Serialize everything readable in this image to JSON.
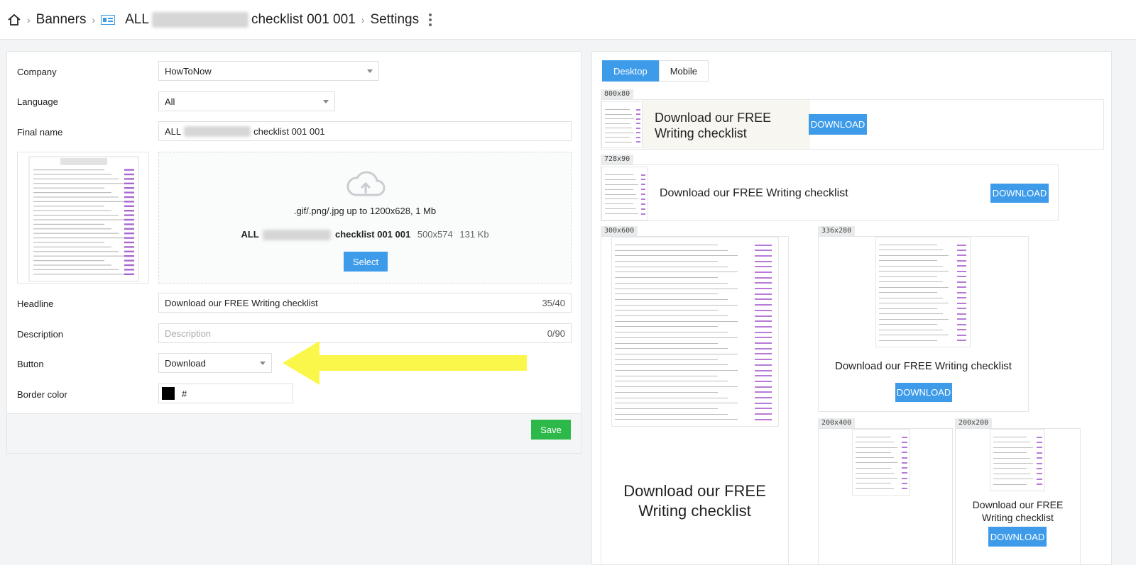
{
  "breadcrumb": {
    "banners": "Banners",
    "name_prefix": "ALL",
    "name_suffix": "checklist 001 001",
    "settings": "Settings"
  },
  "form": {
    "company_label": "Company",
    "company_value": "HowToNow",
    "language_label": "Language",
    "language_value": "All",
    "final_name_label": "Final name",
    "final_name_prefix": "ALL",
    "final_name_suffix": "checklist 001 001",
    "upload_hint": ".gif/.png/.jpg up to 1200x628, 1 Mb",
    "file_prefix": "ALL",
    "file_suffix": "checklist 001 001",
    "file_dims": "500x574",
    "file_size": "131 Kb",
    "select_label": "Select",
    "headline_label": "Headline",
    "headline_value": "Download our FREE Writing checklist",
    "headline_count": "35/40",
    "description_label": "Description",
    "description_placeholder": "Description",
    "description_count": "0/90",
    "button_label": "Button",
    "button_value": "Download",
    "border_label": "Border color",
    "border_value": "#",
    "save_label": "Save"
  },
  "preview": {
    "tab_desktop": "Desktop",
    "tab_mobile": "Mobile",
    "cta": "DOWNLOAD",
    "headline": "Download our FREE Writing checklist",
    "headline_line1": "Download our FREE",
    "headline_line2": "Writing checklist",
    "sizes": [
      "800x80",
      "728x90",
      "300x600",
      "336x280",
      "200x400",
      "200x200"
    ]
  },
  "colors": {
    "accent": "#3d9be9",
    "save": "#2db84a",
    "annotation_arrow": "#fbf74a"
  }
}
